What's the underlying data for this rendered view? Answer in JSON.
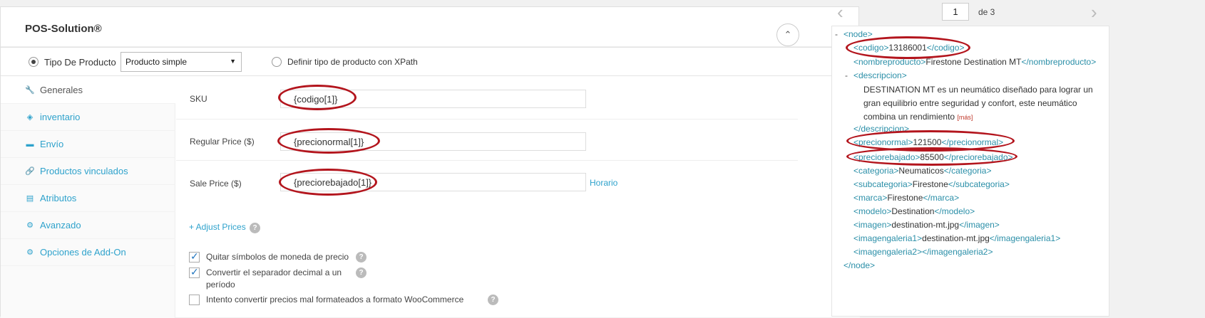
{
  "metabox": {
    "title": "POS-Solution®",
    "collapse_icon": "chevron-up-icon",
    "collapse_glyph": "⌃"
  },
  "product_type": {
    "radio_label": "Tipo De Producto",
    "select_value": "Producto simple",
    "select_arrow": "▼",
    "xpath_label": "Definir tipo de producto con XPath"
  },
  "tabs": [
    {
      "label": "Generales",
      "icon": "wrench-icon",
      "glyph": "🔧",
      "active": true
    },
    {
      "label": "inventario",
      "icon": "tag-icon",
      "glyph": "◈",
      "active": false
    },
    {
      "label": "Envío",
      "icon": "truck-icon",
      "glyph": "▬",
      "active": false
    },
    {
      "label": "Productos vinculados",
      "icon": "link-icon",
      "glyph": "🔗",
      "active": false
    },
    {
      "label": "Atributos",
      "icon": "list-icon",
      "glyph": "▤",
      "active": false
    },
    {
      "label": "Avanzado",
      "icon": "gear-icon",
      "glyph": "⚙",
      "active": false
    },
    {
      "label": "Opciones de Add-On",
      "icon": "gear-icon",
      "glyph": "⚙",
      "active": false
    }
  ],
  "fields": {
    "sku": {
      "label": "SKU",
      "value": "{codigo[1]}"
    },
    "regular_price": {
      "label": "Regular Price ($)",
      "value": "{precionormal[1]}"
    },
    "sale_price": {
      "label": "Sale Price ($)",
      "value": "{preciorebajado[1]}",
      "schedule_link": "Horario"
    },
    "adjust_link": "+ Adjust Prices",
    "help_glyph": "?"
  },
  "options": [
    {
      "label": "Quitar símbolos de moneda de precio",
      "checked": true
    },
    {
      "label": "Convertir el separador decimal a un período",
      "checked": true
    },
    {
      "label": "Intento convertir precios mal formateados a formato WooCommerce",
      "checked": false
    }
  ],
  "pager": {
    "prev_glyph": "‹",
    "next_glyph": "›",
    "current_page": "1",
    "of_text": "de 3"
  },
  "xml": {
    "collapse_dash": "-",
    "node_open": "<node>",
    "node_close": "</node>",
    "codigo": {
      "open": "<codigo>",
      "value": "13186001",
      "close": "</codigo>"
    },
    "nombreproducto": {
      "open": "<nombreproducto>",
      "value": "Firestone Destination MT",
      "close": "</nombreproducto>"
    },
    "descripcion": {
      "open": "<descripcion>",
      "close": "</descripcion>",
      "text": "DESTINATION MT es un neumático diseñado para lograr un gran equilibrio entre seguridad y confort, este neumático combina un rendimiento",
      "more": "[más]"
    },
    "precionormal": {
      "open": "<precionormal>",
      "value": "121500",
      "close": "</precionormal>"
    },
    "preciorebajado": {
      "open": "<preciorebajado>",
      "value": "85500",
      "close": "</preciorebajado>"
    },
    "categoria": {
      "open": "<categoria>",
      "value": "Neumaticos",
      "close": "</categoria>"
    },
    "subcategoria": {
      "open": "<subcategoria>",
      "value": "Firestone",
      "close": "</subcategoria>"
    },
    "marca": {
      "open": "<marca>",
      "value": "Firestone",
      "close": "</marca>"
    },
    "modelo": {
      "open": "<modelo>",
      "value": "Destination",
      "close": "</modelo>"
    },
    "imagen": {
      "open": "<imagen>",
      "value": "destination-mt.jpg",
      "close": "</imagen>"
    },
    "imagengaleria1": {
      "open": "<imagengaleria1>",
      "value": "destination-mt.jpg",
      "close": "</imagengaleria1>"
    },
    "imagengaleria2": {
      "open": "<imagengaleria2>",
      "value": "",
      "close": "</imagengaleria2>"
    }
  },
  "colors": {
    "link": "#2ea2cc",
    "xml_tag": "#2b8fa8",
    "highlight_ellipse": "#b3151d"
  }
}
